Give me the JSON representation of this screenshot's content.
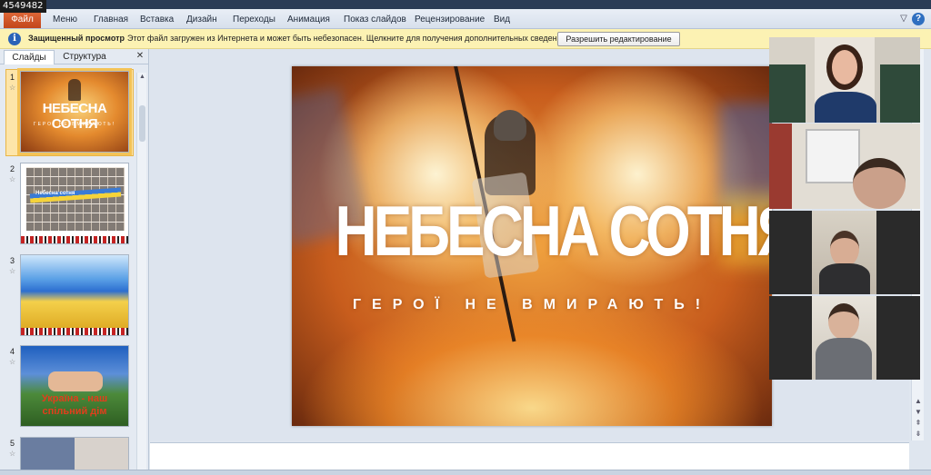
{
  "meeting_id": "4549482",
  "ribbon": {
    "file_tab": "Файл",
    "tabs": [
      "Меню",
      "Главная",
      "Вставка",
      "Дизайн",
      "Переходы",
      "Анимация",
      "Показ слайдов",
      "Рецензирование",
      "Вид"
    ],
    "help_icon": "?",
    "collapse_icon": "▽"
  },
  "protected_view": {
    "title": "Защищенный просмотр",
    "message": "Этот файл загружен из Интернета и может быть небезопасен. Щелкните для получения дополнительных сведений.",
    "button": "Разрешить редактирование",
    "info_icon": "i"
  },
  "slides_pane": {
    "tabs": [
      "Слайды",
      "Структура"
    ],
    "close_icon": "✕",
    "slides": [
      {
        "number": "1",
        "title": "НЕБЕСНА СОТНЯ",
        "subtitle": "ГЕРОЇ НЕ ВМИРАЮТЬ!",
        "selected": true
      },
      {
        "number": "2",
        "label": "Небесна сотня",
        "selected": false
      },
      {
        "number": "3",
        "selected": false
      },
      {
        "number": "4",
        "line1": "Україна - наш",
        "line2": "спільний дім",
        "selected": false
      },
      {
        "number": "5",
        "selected": false
      }
    ]
  },
  "current_slide": {
    "title": "НЕБЕСНА СОТНЯ",
    "subtitle": "ГЕРОЇ НЕ ВМИРАЮТЬ!"
  },
  "colors": {
    "file_tab": "#c9511f",
    "protected_bar": "#fcf2b3",
    "selection": "#f4c356"
  }
}
